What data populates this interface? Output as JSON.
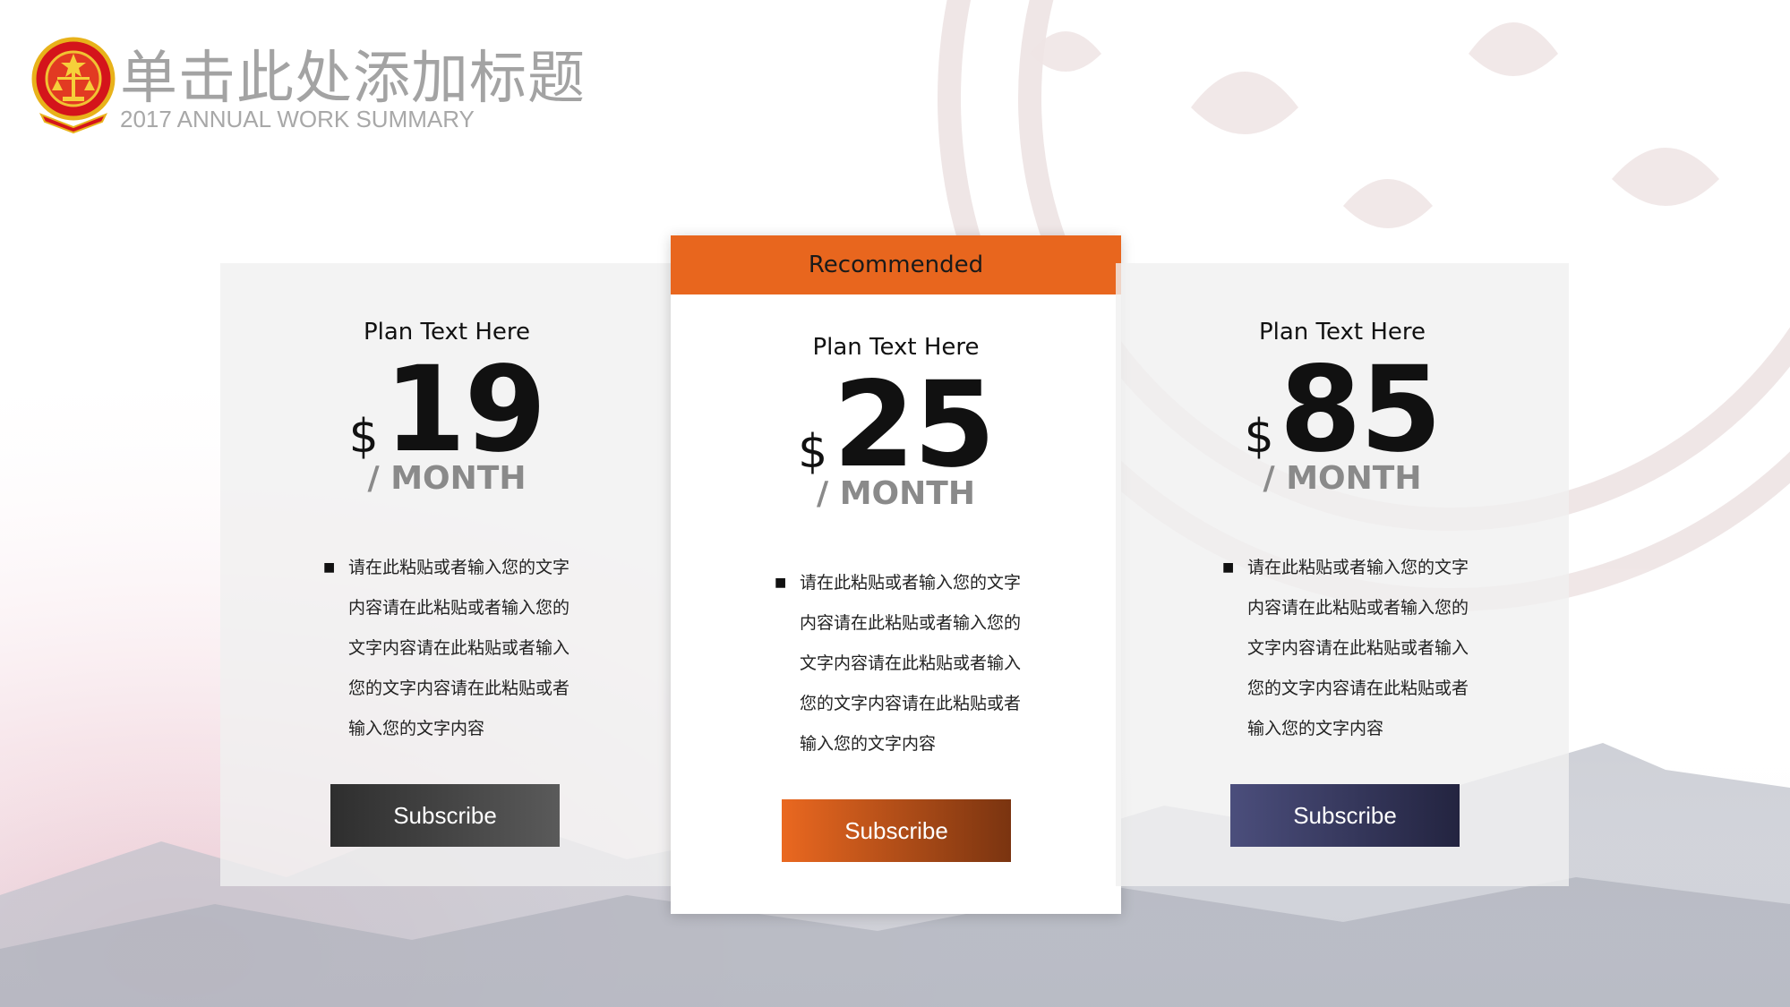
{
  "header": {
    "title": "单击此处添加标题",
    "subtitle": "2017 ANNUAL WORK SUMMARY"
  },
  "colors": {
    "accent_orange": "#e8661e",
    "dark_button": "#3a3a3a",
    "navy_button": "#3c3f66",
    "muted_text": "#8a8a8a"
  },
  "plans": [
    {
      "name": "Plan Text Here",
      "currency": "$",
      "price": "19",
      "period": "/ MONTH",
      "description": [
        "请在此粘贴或者输入您的文字",
        "内容请在此粘贴或者输入您的",
        "文字内容请在此粘贴或者输入",
        "您的文字内容请在此粘贴或者",
        "输入您的文字内容"
      ],
      "button_label": "Subscribe"
    },
    {
      "badge": "Recommended",
      "name": "Plan Text Here",
      "currency": "$",
      "price": "25",
      "period": "/ MONTH",
      "description": [
        "请在此粘贴或者输入您的文字",
        "内容请在此粘贴或者输入您的",
        "文字内容请在此粘贴或者输入",
        "您的文字内容请在此粘贴或者",
        "输入您的文字内容"
      ],
      "button_label": "Subscribe"
    },
    {
      "name": "Plan Text Here",
      "currency": "$",
      "price": "85",
      "period": "/ MONTH",
      "description": [
        "请在此粘贴或者输入您的文字",
        "内容请在此粘贴或者输入您的",
        "文字内容请在此粘贴或者输入",
        "您的文字内容请在此粘贴或者",
        "输入您的文字内容"
      ],
      "button_label": "Subscribe"
    }
  ]
}
